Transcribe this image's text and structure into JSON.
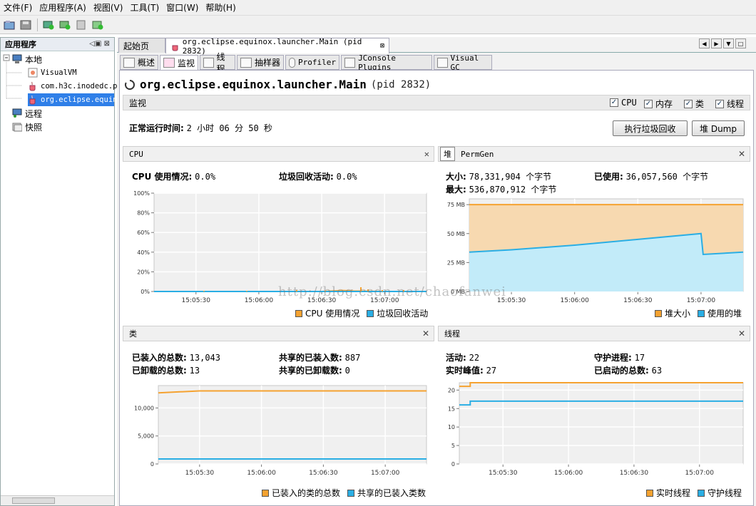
{
  "menubar": {
    "items": [
      "文件(F)",
      "应用程序(A)",
      "视图(V)",
      "工具(T)",
      "窗口(W)",
      "帮助(H)"
    ]
  },
  "toolbar": {
    "icons": [
      "open-icon",
      "save-icon",
      "add-jmx-icon",
      "add-host-icon",
      "add-snapshot-icon",
      "add-coredump-icon"
    ]
  },
  "leftpanel": {
    "title": "应用程序",
    "controls": "◁▣ ⊠",
    "tree": {
      "local": "本地",
      "visualvm": "VisualVM",
      "h3c": "com.h3c.inodedc.p",
      "eclipse": "org.eclipse.equin",
      "remote": "远程",
      "snapshots": "快照"
    }
  },
  "doctabs": {
    "start": "起始页",
    "main": "org.eclipse.equinox.launcher.Main (pid 2832)"
  },
  "subtabs": [
    "概述",
    "监视",
    "线程",
    "抽样器",
    "Profiler",
    "JConsole Plugins",
    "Visual GC"
  ],
  "page": {
    "title": "org.eclipse.equinox.launcher.Main",
    "pid": "(pid 2832)"
  },
  "monitor": {
    "label": "监视",
    "checks": [
      "CPU",
      "内存",
      "类",
      "线程"
    ],
    "uptime_label": "正常运行时间:",
    "uptime_value": "2 小时 06 分 50 秒",
    "gc_button": "执行垃圾回收",
    "heapdump_button": "堆 Dump"
  },
  "cpu": {
    "title": "CPU",
    "usage_label": "CPU 使用情况:",
    "usage_value": "0.0%",
    "gc_label": "垃圾回收活动:",
    "gc_value": "0.0%",
    "yticks": [
      "100%",
      "80%",
      "60%",
      "40%",
      "20%",
      "0%"
    ],
    "xticks": [
      "15:05:30",
      "15:06:00",
      "15:06:30",
      "15:07:00"
    ],
    "legend": [
      "CPU 使用情况",
      "垃圾回收活动"
    ]
  },
  "heap": {
    "tab_heap": "堆",
    "tab_perm": "PermGen",
    "size_label": "大小:",
    "size_value": "78,331,904 个字节",
    "used_label": "已使用:",
    "used_value": "36,057,560 个字节",
    "max_label": "最大:",
    "max_value": "536,870,912 个字节",
    "yticks": [
      "75 MB",
      "50 MB",
      "25 MB",
      "0 MB"
    ],
    "xticks": [
      "15:05:30",
      "15:06:00",
      "15:06:30",
      "15:07:00"
    ],
    "legend": [
      "堆大小",
      "使用的堆"
    ]
  },
  "classes": {
    "title": "类",
    "loaded_label": "已装入的总数:",
    "loaded_value": "13,043",
    "shared_loaded_label": "共享的已装入数:",
    "shared_loaded_value": "887",
    "unloaded_label": "已卸载的总数:",
    "unloaded_value": "13",
    "shared_unloaded_label": "共享的已卸载数:",
    "shared_unloaded_value": "0",
    "yticks": [
      "10,000",
      "5,000",
      "0"
    ],
    "xticks": [
      "15:05:30",
      "15:06:00",
      "15:06:30",
      "15:07:00"
    ],
    "legend": [
      "已装入的类的总数",
      "共享的已装入类数"
    ]
  },
  "threads": {
    "title": "线程",
    "live_label": "活动:",
    "live_value": "22",
    "daemon_label": "守护进程:",
    "daemon_value": "17",
    "peak_label": "实时峰值:",
    "peak_value": "27",
    "started_label": "已启动的总数:",
    "started_value": "63",
    "yticks": [
      "20",
      "15",
      "10",
      "5",
      "0"
    ],
    "xticks": [
      "15:05:30",
      "15:06:00",
      "15:06:30",
      "15:07:00"
    ],
    "legend": [
      "实时线程",
      "守护线程"
    ]
  },
  "watermark": "http://blog.csdn.net/chaofanwei",
  "colors": {
    "orange": "#f5a230",
    "blue": "#2aaee4",
    "heapFill": "#f7d9b0",
    "usedFill": "#c2ebf9",
    "selection": "#2f7fe8"
  },
  "chart_data": [
    {
      "type": "line",
      "title": "CPU",
      "x": [
        "15:05:10",
        "15:05:30",
        "15:06:00",
        "15:06:30",
        "15:06:40",
        "15:06:45",
        "15:07:00",
        "15:07:20"
      ],
      "series": [
        {
          "name": "CPU 使用情况",
          "values": [
            0,
            0,
            0,
            0,
            1,
            0.5,
            0,
            0
          ]
        },
        {
          "name": "垃圾回收活动",
          "values": [
            0,
            0,
            0,
            0,
            0,
            0,
            0,
            0
          ]
        }
      ],
      "ylim": [
        0,
        100
      ]
    },
    {
      "type": "area",
      "title": "堆",
      "x": [
        "15:05:10",
        "15:05:30",
        "15:06:00",
        "15:06:30",
        "15:07:00",
        "15:07:01",
        "15:07:20"
      ],
      "series": [
        {
          "name": "堆大小",
          "values": [
            75,
            75,
            75,
            75,
            75,
            75,
            75
          ]
        },
        {
          "name": "使用的堆",
          "values": [
            34,
            36,
            40,
            45,
            50,
            32,
            34
          ]
        }
      ],
      "ylim": [
        0,
        80
      ]
    },
    {
      "type": "line",
      "title": "类",
      "x": [
        "15:05:10",
        "15:05:30",
        "15:06:00",
        "15:06:30",
        "15:07:00",
        "15:07:20"
      ],
      "series": [
        {
          "name": "已装入的类的总数",
          "values": [
            12700,
            13043,
            13043,
            13043,
            13043,
            13043
          ]
        },
        {
          "name": "共享的已装入类数",
          "values": [
            887,
            887,
            887,
            887,
            887,
            887
          ]
        }
      ],
      "ylim": [
        0,
        14000
      ]
    },
    {
      "type": "line",
      "title": "线程",
      "x": [
        "15:05:10",
        "15:05:15",
        "15:05:30",
        "15:06:00",
        "15:06:30",
        "15:07:00",
        "15:07:20"
      ],
      "series": [
        {
          "name": "实时线程",
          "values": [
            21,
            22,
            22,
            22,
            22,
            22,
            22
          ]
        },
        {
          "name": "守护线程",
          "values": [
            16,
            17,
            17,
            17,
            17,
            17,
            17
          ]
        }
      ],
      "ylim": [
        0,
        22
      ]
    }
  ]
}
